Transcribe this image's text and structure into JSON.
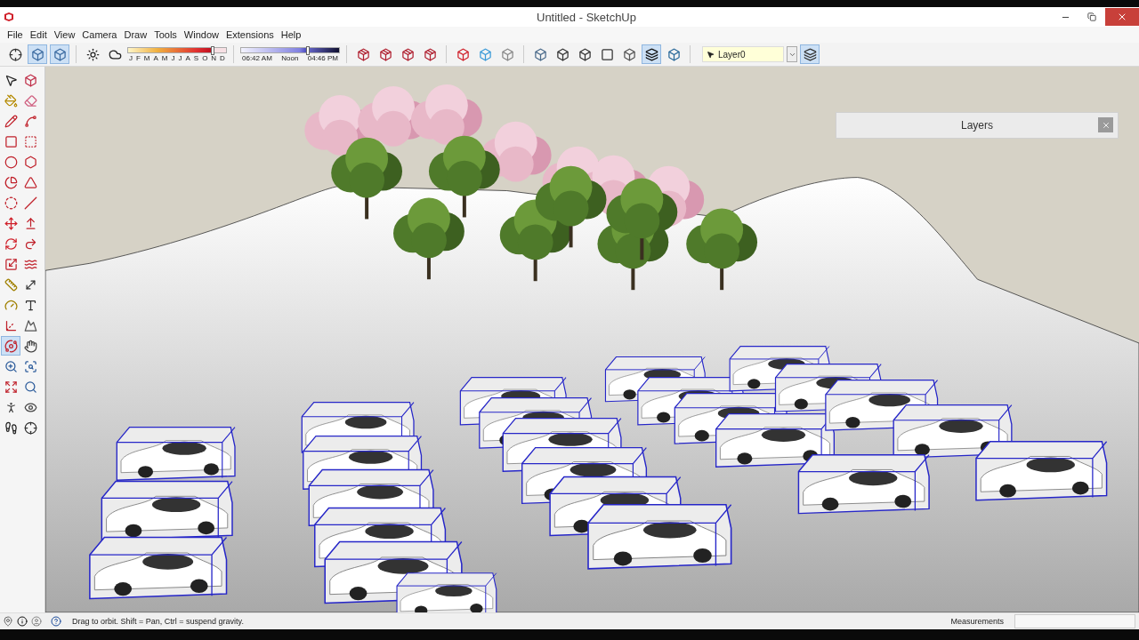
{
  "window": {
    "title": "Untitled - SketchUp"
  },
  "menu": [
    "File",
    "Edit",
    "View",
    "Camera",
    "Draw",
    "Tools",
    "Window",
    "Extensions",
    "Help"
  ],
  "toolbar": {
    "view_buttons": [
      {
        "selected": false
      },
      {
        "selected": true
      },
      {
        "selected": true
      }
    ],
    "shadow_date": {
      "months": [
        "J",
        "F",
        "M",
        "A",
        "M",
        "J",
        "J",
        "A",
        "S",
        "O",
        "N",
        "D"
      ],
      "level": 0.86
    },
    "shadow_time": {
      "start": "06:42 AM",
      "middle": "Noon",
      "end": "04:46 PM",
      "level": 0.68
    },
    "style_buttons": [
      {
        "selected": false
      },
      {
        "selected": false
      },
      {
        "selected": false
      },
      {
        "selected": false
      },
      {
        "selected": false
      },
      {
        "selected": true
      },
      {
        "selected": false
      }
    ],
    "layer": {
      "value": "Layer0"
    },
    "layer_button": {
      "selected": true
    }
  },
  "tool_palette": [
    {
      "selected": false
    },
    {
      "selected": false
    },
    {
      "selected": false
    },
    {
      "selected": false
    },
    {
      "selected": false
    },
    {
      "selected": false
    },
    {
      "selected": false
    },
    {
      "selected": false
    },
    {
      "selected": false
    },
    {
      "selected": false
    },
    {
      "selected": false
    },
    {
      "selected": false
    },
    {
      "selected": false
    },
    {
      "selected": false
    },
    {
      "selected": false
    },
    {
      "selected": false
    },
    {
      "selected": false
    },
    {
      "selected": false
    },
    {
      "selected": false
    },
    {
      "selected": false
    },
    {
      "selected": false
    },
    {
      "selected": false
    },
    {
      "selected": false
    },
    {
      "selected": false
    },
    {
      "selected": false
    },
    {
      "selected": false
    },
    {
      "selected": true
    },
    {
      "selected": false
    },
    {
      "selected": false
    },
    {
      "selected": false
    },
    {
      "selected": false
    },
    {
      "selected": false
    },
    {
      "selected": false
    },
    {
      "selected": false
    },
    {
      "selected": false
    },
    {
      "selected": false
    }
  ],
  "layers_panel": {
    "title": "Layers"
  },
  "status_bar": {
    "hint": "Drag to orbit. Shift = Pan, Ctrl = suspend gravity.",
    "measurements_label": "Measurements"
  }
}
